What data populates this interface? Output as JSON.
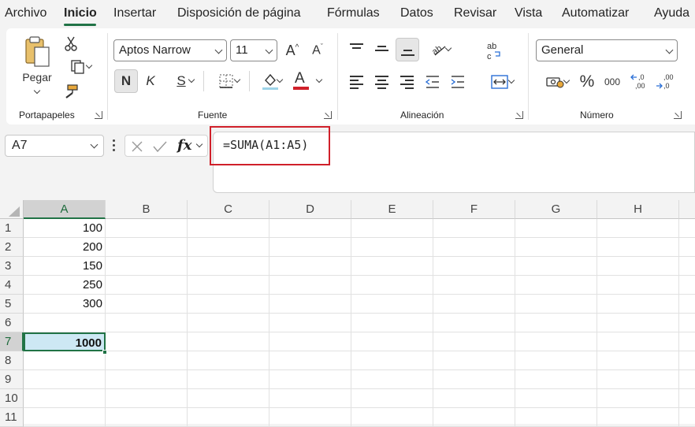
{
  "menu": {
    "tabs": [
      "Archivo",
      "Inicio",
      "Insertar",
      "Disposición de página",
      "Fórmulas",
      "Datos",
      "Revisar",
      "Vista",
      "Automatizar",
      "Ayuda"
    ],
    "active": "Inicio"
  },
  "ribbon": {
    "clipboard": {
      "paste_label": "Pegar",
      "group_label": "Portapapeles"
    },
    "font": {
      "font_name": "Aptos Narrow",
      "font_size": "11",
      "bold_label": "N",
      "italic_label": "K",
      "underline_label": "S",
      "group_label": "Fuente",
      "font_color": "#d0202a"
    },
    "alignment": {
      "group_label": "Alineación"
    },
    "number": {
      "format": "General",
      "percent_label": "%",
      "thousands_label": "000",
      "group_label": "Número"
    }
  },
  "formula_bar": {
    "name_box": "A7",
    "fx_label": "fx",
    "formula": "=SUMA(A1:A5)"
  },
  "sheet": {
    "columns": [
      "A",
      "B",
      "C",
      "D",
      "E",
      "F",
      "G",
      "H"
    ],
    "rows": [
      "1",
      "2",
      "3",
      "4",
      "5",
      "6",
      "7",
      "8",
      "9",
      "10",
      "11"
    ],
    "column_a_values": [
      "100",
      "200",
      "150",
      "250",
      "300",
      "",
      "1000",
      "",
      "",
      "",
      ""
    ],
    "selected_cell": "A7",
    "accent_color": "#217346",
    "highlight_color": "#d0202a"
  }
}
